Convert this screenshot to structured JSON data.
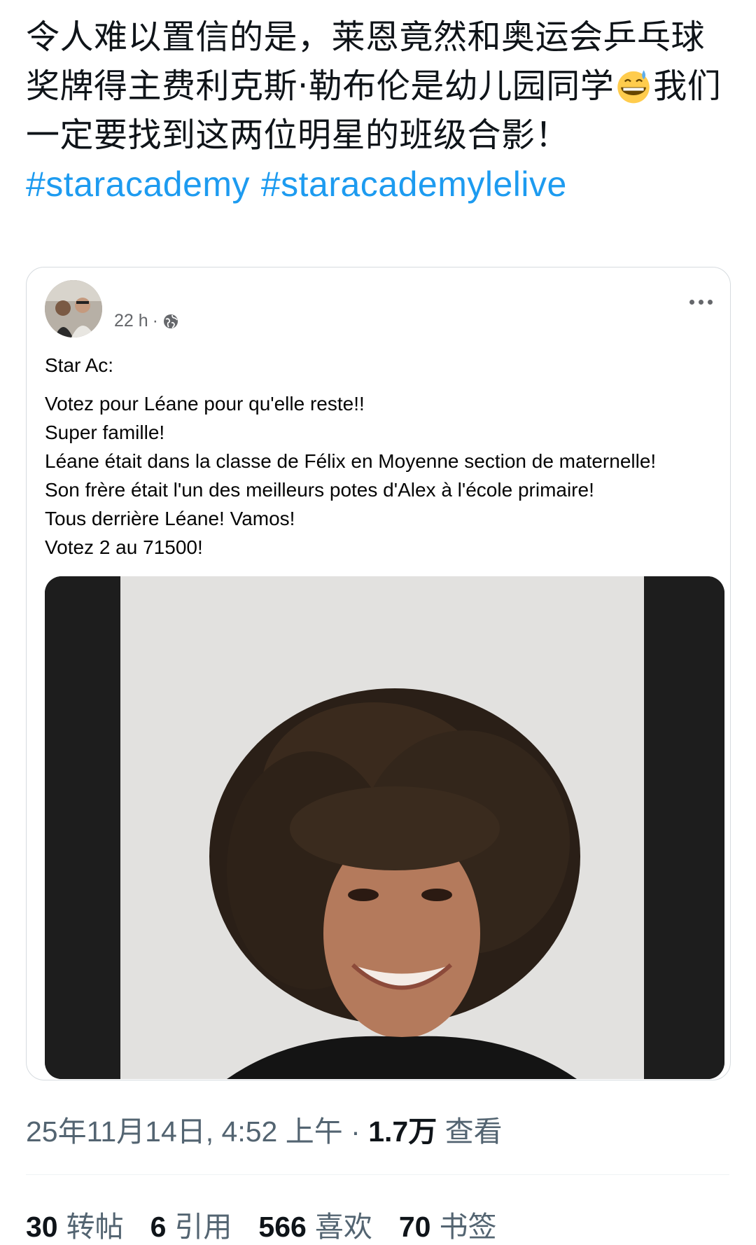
{
  "tweet": {
    "text_before_emoji": "令人难以置信的是，莱恩竟然和奥运会乒乓球奖牌得主费利克斯·勒布伦是幼儿园同学",
    "emoji_name": "grinning-face-with-sweat-icon",
    "text_after_emoji": "我们一定要找到这两位明星的班级合影！",
    "hashtags": [
      "#staracademy",
      "#staracademylelive"
    ]
  },
  "quoted_post": {
    "time": "22 h",
    "separator": "·",
    "privacy_icon": "globe-icon",
    "title": "Star Ac:",
    "lines": [
      "Votez pour Léane pour qu'elle reste!!",
      "Super famille!",
      "Léane était dans la classe de Félix en Moyenne section de maternelle!",
      "Son frère était l'un des meilleurs potes d'Alex à l'école primaire!",
      "Tous derrière Léane! Vamos!",
      "Votez 2 au 71500!"
    ],
    "more_icon": "more-horizontal-icon"
  },
  "meta": {
    "datetime": "25年11月14日, 4:52 上午",
    "dot": "·",
    "views_count": "1.7万",
    "views_label": "查看"
  },
  "stats": [
    {
      "count": "30",
      "label": "转帖"
    },
    {
      "count": "6",
      "label": "引用"
    },
    {
      "count": "566",
      "label": "喜欢"
    },
    {
      "count": "70",
      "label": "书签"
    }
  ],
  "colors": {
    "hashtag": "#1d9bf0",
    "secondary_text": "#536471",
    "primary_text": "#0f1419"
  }
}
